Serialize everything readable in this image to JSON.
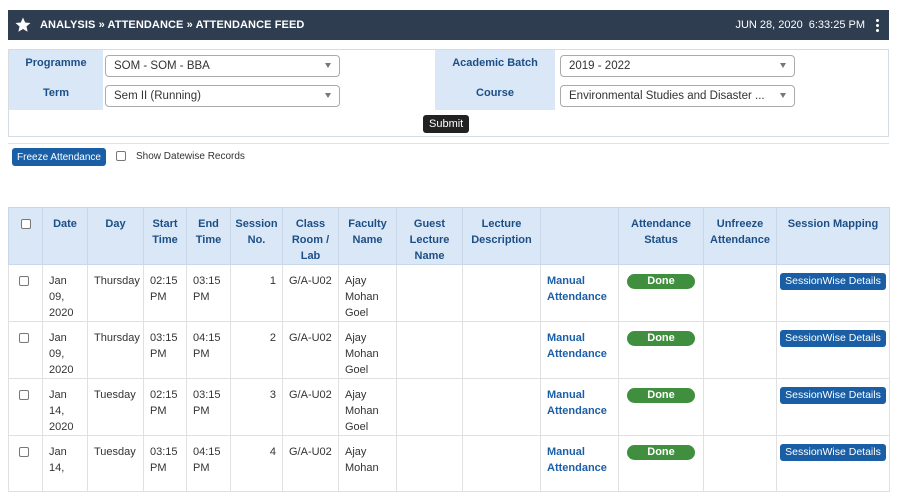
{
  "header": {
    "breadcrumb": "ANALYSIS » ATTENDANCE » ATTENDANCE FEED",
    "date": "JUN 28, 2020",
    "time": "6:33:25 PM"
  },
  "filters": {
    "programme_label": "Programme",
    "programme_value": "SOM - SOM - BBA",
    "term_label": "Term",
    "term_value": "Sem II (Running)",
    "batch_label": "Academic Batch",
    "batch_value": "2019 - 2022",
    "course_label": "Course",
    "course_value": "Environmental Studies and Disaster ...",
    "submit_label": "Submit"
  },
  "actions": {
    "freeze_label": "Freeze Attendance",
    "datewise_label": "Show Datewise Records"
  },
  "table": {
    "headers": {
      "date": "Date",
      "day": "Day",
      "start": "Start Time",
      "end": "End Time",
      "session": "Session No.",
      "room": "Class Room / Lab",
      "faculty": "Faculty Name",
      "guest": "Guest Lecture Name",
      "lecture": "Lecture Description",
      "status": "Attendance Status",
      "unfreeze": "Unfreeze Attendance",
      "mapping": "Session Mapping"
    },
    "rows": [
      {
        "date": "Jan 09, 2020",
        "day": "Thursday",
        "start": "02:15 PM",
        "end": "03:15 PM",
        "session": "1",
        "room": "G/A-U02",
        "faculty": "Ajay Mohan Goel",
        "action": "Manual Attendance",
        "status": "Done",
        "mapping": "SessionWise Details"
      },
      {
        "date": "Jan 09, 2020",
        "day": "Thursday",
        "start": "03:15 PM",
        "end": "04:15 PM",
        "session": "2",
        "room": "G/A-U02",
        "faculty": "Ajay Mohan Goel",
        "action": "Manual Attendance",
        "status": "Done",
        "mapping": "SessionWise Details"
      },
      {
        "date": "Jan 14, 2020",
        "day": "Tuesday",
        "start": "02:15 PM",
        "end": "03:15 PM",
        "session": "3",
        "room": "G/A-U02",
        "faculty": "Ajay Mohan Goel",
        "action": "Manual Attendance",
        "status": "Done",
        "mapping": "SessionWise Details"
      },
      {
        "date": "Jan 14,",
        "day": "Tuesday",
        "start": "03:15 PM",
        "end": "04:15 PM",
        "session": "4",
        "room": "G/A-U02",
        "faculty": "Ajay Mohan",
        "action": "Manual Attendance",
        "status": "Done",
        "mapping": "SessionWise Details"
      }
    ]
  },
  "colors": {
    "header_bg": "#2e3d4f",
    "label_bg": "#dae7f7",
    "label_text": "#1c4f86",
    "primary_button": "#1a5fa5",
    "done_badge": "#3f8f3e"
  },
  "icons": [
    "star-icon",
    "kebab-menu-icon",
    "dropdown-caret-icon",
    "checkbox-icon"
  ]
}
